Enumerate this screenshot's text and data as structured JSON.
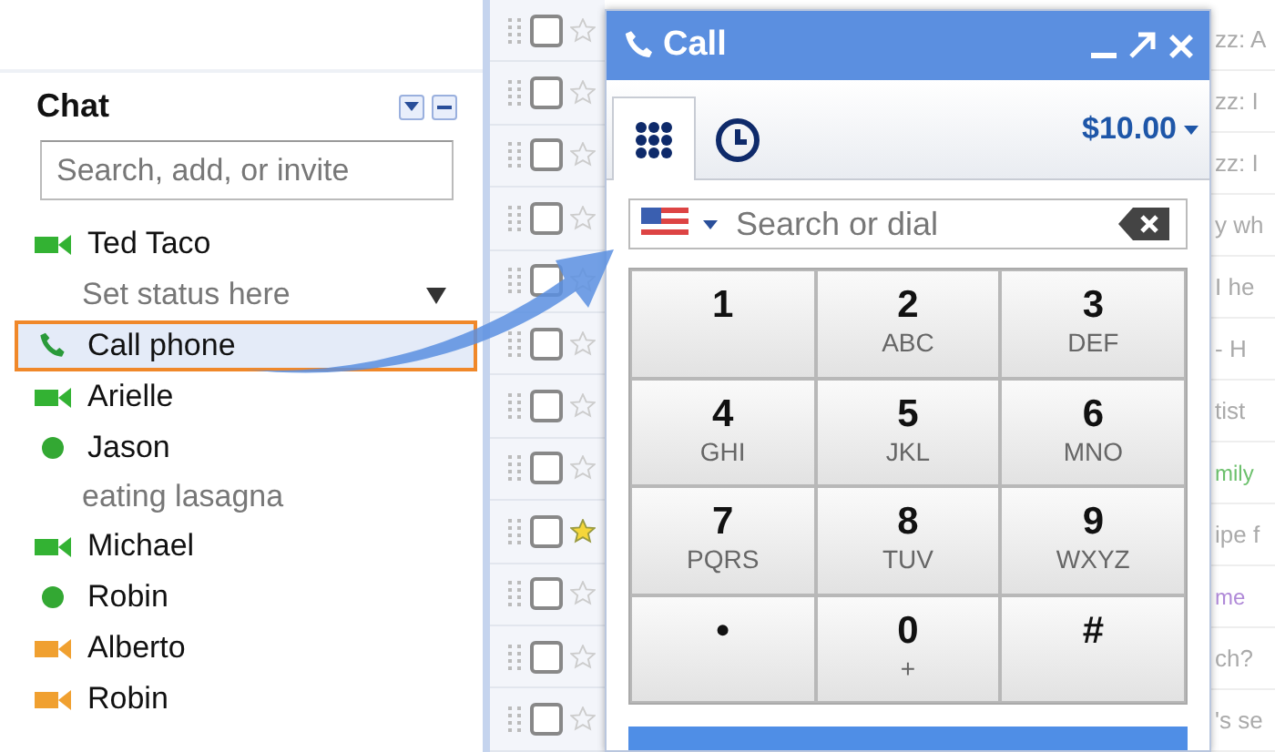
{
  "chat": {
    "title": "Chat",
    "search": {
      "placeholder": "Search, add, or invite"
    },
    "me": {
      "name": "Ted Taco",
      "kind": "video",
      "status": "Set status here"
    },
    "contacts": [
      {
        "name": "Call phone",
        "kind": "phone",
        "selected": true
      },
      {
        "name": "Arielle",
        "kind": "video",
        "selected": false
      },
      {
        "name": "Jason",
        "kind": "online",
        "status": "eating lasagna",
        "selected": false
      },
      {
        "name": "Michael",
        "kind": "video",
        "selected": false
      },
      {
        "name": "Robin",
        "kind": "online",
        "selected": false
      },
      {
        "name": "Alberto",
        "kind": "video-idle",
        "selected": false
      },
      {
        "name": "Robin",
        "kind": "video-idle",
        "selected": false
      }
    ]
  },
  "mail_rows": [
    {
      "checked": false,
      "starred": false,
      "snippet": "zz: A"
    },
    {
      "checked": false,
      "starred": false,
      "snippet": "zz: I"
    },
    {
      "checked": false,
      "starred": false,
      "snippet": "zz: I"
    },
    {
      "checked": false,
      "starred": false,
      "snippet": "y wh"
    },
    {
      "checked": false,
      "starred": false,
      "snippet": "I he"
    },
    {
      "checked": false,
      "starred": false,
      "snippet": "- H"
    },
    {
      "checked": false,
      "starred": false,
      "snippet": "tist"
    },
    {
      "checked": false,
      "starred": false,
      "snippet": "mily",
      "color": "#6cc06c"
    },
    {
      "checked": false,
      "starred": true,
      "snippet": "ipe f"
    },
    {
      "checked": false,
      "starred": false,
      "snippet": "me",
      "color": "#b08ad8"
    },
    {
      "checked": false,
      "starred": false,
      "snippet": "ch?"
    },
    {
      "checked": false,
      "starred": false,
      "snippet": "'s se"
    }
  ],
  "call_window": {
    "title": "Call",
    "tabs": [
      {
        "kind": "dialpad",
        "selected": true
      },
      {
        "kind": "history",
        "selected": false
      }
    ],
    "credit": "$10.00",
    "dial": {
      "placeholder": "Search or dial"
    },
    "keys": [
      {
        "digit": "1"
      },
      {
        "digit": "2",
        "letters": "ABC"
      },
      {
        "digit": "3",
        "letters": "DEF"
      },
      {
        "digit": "4",
        "letters": "GHI"
      },
      {
        "digit": "5",
        "letters": "JKL"
      },
      {
        "digit": "6",
        "letters": "MNO"
      },
      {
        "digit": "7",
        "letters": "PQRS"
      },
      {
        "digit": "8",
        "letters": "TUV"
      },
      {
        "digit": "9",
        "letters": "WXYZ"
      },
      {
        "digit": "•"
      },
      {
        "digit": "0",
        "letters": "+"
      },
      {
        "digit": "#"
      }
    ]
  }
}
